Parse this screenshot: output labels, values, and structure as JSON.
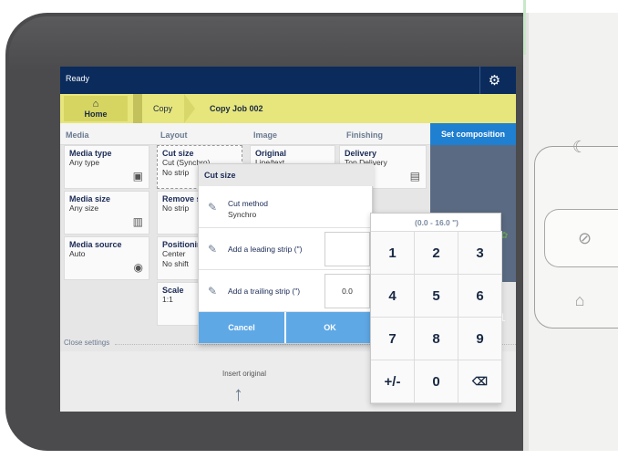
{
  "status": {
    "text": "Ready",
    "settings_icon": "gear-icon"
  },
  "breadcrumb": {
    "home_label": "Home",
    "copy_label": "Copy",
    "job_label": "Copy Job 002"
  },
  "tabs": {
    "media": "Media",
    "layout": "Layout",
    "image": "Image",
    "finishing": "Finishing",
    "set_composition": "Set composition"
  },
  "media": {
    "type_title": "Media type",
    "type_value": "Any type",
    "size_title": "Media size",
    "size_value": "Any size",
    "source_title": "Media source",
    "source_value": "Auto"
  },
  "layout": {
    "cut_title": "Cut size",
    "cut_value1": "Cut (Synchro)",
    "cut_value2": "No strip",
    "remove_title": "Remove s",
    "remove_value": "No strip",
    "position_title": "Positionin",
    "position_value1": "Center",
    "position_value2": "No shift",
    "scale_title": "Scale",
    "scale_value": "1:1"
  },
  "image": {
    "original_title": "Original",
    "original_value": "Line/text"
  },
  "finishing": {
    "delivery_title": "Delivery",
    "delivery_value": "Top Delivery"
  },
  "close_settings": "Close settings",
  "insert_original": "Insert original",
  "dialog": {
    "title": "Cut size",
    "method_label": "Cut method",
    "method_value": "Synchro",
    "leading_label": "Add a leading strip (\")",
    "leading_value": "",
    "trailing_label": "Add a trailing strip (\")",
    "trailing_value": "0.0",
    "cancel": "Cancel",
    "ok": "OK"
  },
  "keypad": {
    "range": "(0.0 - 16.0 \")",
    "keys": [
      "1",
      "2",
      "3",
      "4",
      "5",
      "6",
      "7",
      "8",
      "9",
      "+/-",
      "0",
      "⌫"
    ]
  },
  "colors": {
    "status_bar": "#0a2b5c",
    "breadcrumb": "#e7e67c",
    "accent": "#1f7fd0",
    "dialog_button": "#5ea8e6"
  },
  "side_number": "1"
}
